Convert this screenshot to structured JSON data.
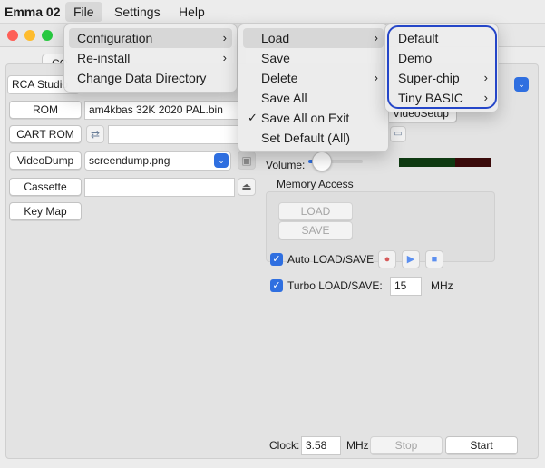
{
  "menubar": {
    "app_name": "Emma 02",
    "items": [
      "File",
      "Settings",
      "Help"
    ]
  },
  "file_menu": {
    "items": [
      {
        "label": "Configuration",
        "submenu": true
      },
      {
        "label": "Re-install",
        "submenu": true
      },
      {
        "label": "Change Data Directory",
        "submenu": false
      }
    ]
  },
  "config_menu": {
    "items": [
      {
        "label": "Load",
        "submenu": true
      },
      {
        "label": "Save",
        "submenu": false
      },
      {
        "label": "Delete",
        "submenu": true
      },
      {
        "label": "Save All",
        "submenu": false
      },
      {
        "label": "Save All on Exit",
        "checked": true
      },
      {
        "label": "Set Default (All)",
        "submenu": false
      }
    ]
  },
  "load_menu": {
    "items": [
      {
        "label": "Default",
        "submenu": false
      },
      {
        "label": "Demo",
        "submenu": false
      },
      {
        "label": "Super-chip",
        "submenu": true
      },
      {
        "label": "Tiny BASIC",
        "submenu": true
      }
    ]
  },
  "glyphs": {
    "chevron": "›",
    "check": "✓",
    "dropdown": "⌄",
    "checkbox": "✓"
  },
  "tabs": {
    "co": "CO"
  },
  "machine_select": {
    "value": "RCA Studio"
  },
  "rom": {
    "button": "ROM",
    "value": "am4kbas 32K 2020 PAL.bin"
  },
  "cart_rom": {
    "button": "CART ROM",
    "value": ""
  },
  "video_dump": {
    "button": "VideoDump",
    "value": "screendump.png"
  },
  "cassette": {
    "button": "Cassette",
    "value": ""
  },
  "key_map": {
    "button": "Key Map"
  },
  "video_setup": {
    "button": "VideoSetup"
  },
  "volume": {
    "label": "Volume:",
    "level": 0.25
  },
  "memory_access": {
    "title": "Memory Access",
    "load_button": "LOAD",
    "save_button": "SAVE"
  },
  "auto_load_save": {
    "label": "Auto LOAD/SAVE",
    "checked": true
  },
  "turbo_load_save": {
    "label": "Turbo LOAD/SAVE:",
    "checked": true,
    "value": "15",
    "unit": "MHz"
  },
  "clock": {
    "label": "Clock:",
    "value": "3.58",
    "unit": "MHz"
  },
  "stop_button": "Stop",
  "start_button": "Start",
  "colors": {
    "accent": "#2f6fe0",
    "ring": "#2546c8",
    "close": "#fe5f57",
    "minimize": "#febc2e",
    "zoom": "#28c840",
    "record": "#d65a5a",
    "play": "#5b8ff0"
  }
}
